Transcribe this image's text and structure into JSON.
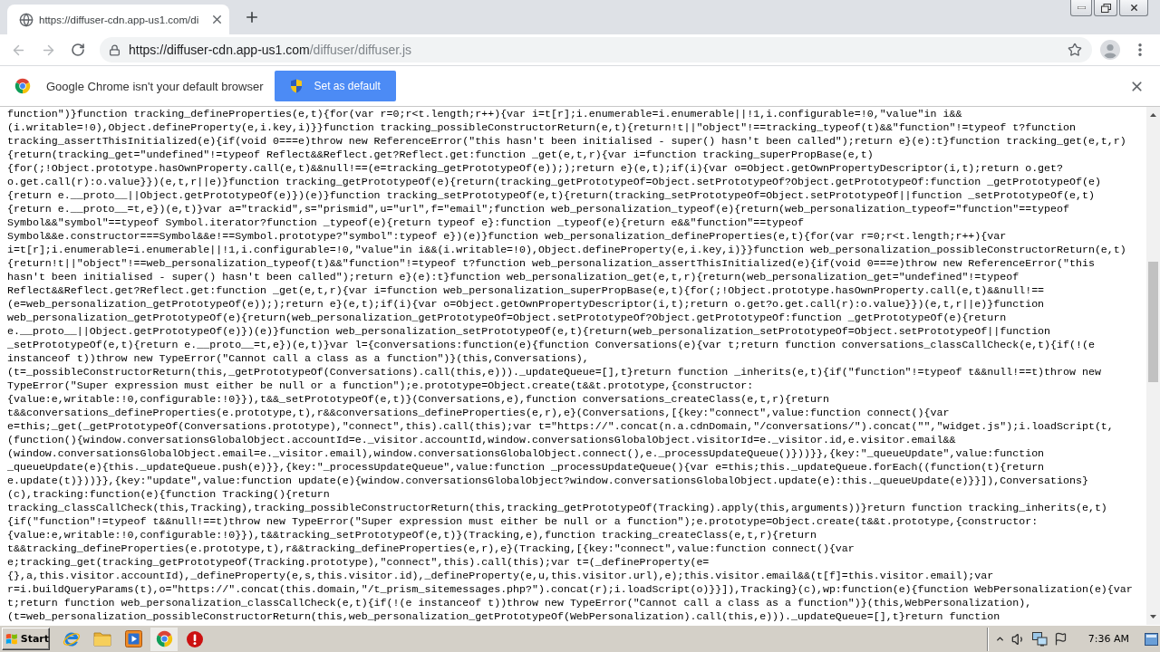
{
  "window": {
    "tabs": [
      {
        "title": "https://diffuser-cdn.app-us1.com/di",
        "selected": true
      }
    ]
  },
  "toolbar": {
    "url_host": "https://diffuser-cdn.app-us1.com",
    "url_path": "/diffuser/diffuser.js"
  },
  "infobar": {
    "message": "Google Chrome isn't your default browser",
    "button": "Set as default"
  },
  "page": {
    "lines": [
      "function\")}function tracking_defineProperties(e,t){for(var r=0;r<t.length;r++){var i=t[r];i.enumerable=i.enumerable||!1,i.configurable=!0,\"value\"in i&&",
      "(i.writable=!0),Object.defineProperty(e,i.key,i)}}function tracking_possibleConstructorReturn(e,t){return!t||\"object\"!==tracking_typeof(t)&&\"function\"!=typeof t?function",
      "tracking_assertThisInitialized(e){if(void 0===e)throw new ReferenceError(\"this hasn't been initialised - super() hasn't been called\");return e}(e):t}function tracking_get(e,t,r)",
      "{return(tracking_get=\"undefined\"!=typeof Reflect&&Reflect.get?Reflect.get:function _get(e,t,r){var i=function tracking_superPropBase(e,t)",
      "{for(;!Object.prototype.hasOwnProperty.call(e,t)&&null!==(e=tracking_getPrototypeOf(e)););return e}(e,t);if(i){var o=Object.getOwnPropertyDescriptor(i,t);return o.get?",
      "o.get.call(r):o.value}})(e,t,r||e)}function tracking_getPrototypeOf(e){return(tracking_getPrototypeOf=Object.setPrototypeOf?Object.getPrototypeOf:function _getPrototypeOf(e)",
      "{return e.__proto__||Object.getPrototypeOf(e)})(e)}function tracking_setPrototypeOf(e,t){return(tracking_setPrototypeOf=Object.setPrototypeOf||function _setPrototypeOf(e,t)",
      "{return e.__proto__=t,e})(e,t)}var a=\"trackid\",s=\"prismid\",u=\"url\",f=\"email\";function web_personalization_typeof(e){return(web_personalization_typeof=\"function\"==typeof",
      "Symbol&&\"symbol\"==typeof Symbol.iterator?function _typeof(e){return typeof e}:function _typeof(e){return e&&\"function\"==typeof",
      "Symbol&&e.constructor===Symbol&&e!==Symbol.prototype?\"symbol\":typeof e})(e)}function web_personalization_defineProperties(e,t){for(var r=0;r<t.length;r++){var",
      "i=t[r];i.enumerable=i.enumerable||!1,i.configurable=!0,\"value\"in i&&(i.writable=!0),Object.defineProperty(e,i.key,i)}}function web_personalization_possibleConstructorReturn(e,t)",
      "{return!t||\"object\"!==web_personalization_typeof(t)&&\"function\"!=typeof t?function web_personalization_assertThisInitialized(e){if(void 0===e)throw new ReferenceError(\"this",
      "hasn't been initialised - super() hasn't been called\");return e}(e):t}function web_personalization_get(e,t,r){return(web_personalization_get=\"undefined\"!=typeof",
      "Reflect&&Reflect.get?Reflect.get:function _get(e,t,r){var i=function web_personalization_superPropBase(e,t){for(;!Object.prototype.hasOwnProperty.call(e,t)&&null!==",
      "(e=web_personalization_getPrototypeOf(e)););return e}(e,t);if(i){var o=Object.getOwnPropertyDescriptor(i,t);return o.get?o.get.call(r):o.value}})(e,t,r||e)}function",
      "web_personalization_getPrototypeOf(e){return(web_personalization_getPrototypeOf=Object.setPrototypeOf?Object.getPrototypeOf:function _getPrototypeOf(e){return",
      "e.__proto__||Object.getPrototypeOf(e)})(e)}function web_personalization_setPrototypeOf(e,t){return(web_personalization_setPrototypeOf=Object.setPrototypeOf||function",
      "_setPrototypeOf(e,t){return e.__proto__=t,e})(e,t)}var l={conversations:function(e){function Conversations(e){var t;return function conversations_classCallCheck(e,t){if(!(e",
      "instanceof t))throw new TypeError(\"Cannot call a class as a function\")}(this,Conversations),",
      "(t=_possibleConstructorReturn(this,_getPrototypeOf(Conversations).call(this,e)))._updateQueue=[],t}return function _inherits(e,t){if(\"function\"!=typeof t&&null!==t)throw new",
      "TypeError(\"Super expression must either be null or a function\");e.prototype=Object.create(t&&t.prototype,{constructor:",
      "{value:e,writable:!0,configurable:!0}}),t&&_setPrototypeOf(e,t)}(Conversations,e),function conversations_createClass(e,t,r){return",
      "t&&conversations_defineProperties(e.prototype,t),r&&conversations_defineProperties(e,r),e}(Conversations,[{key:\"connect\",value:function connect(){var",
      "e=this;_get(_getPrototypeOf(Conversations.prototype),\"connect\",this).call(this);var t=\"https://\".concat(n.a.cdnDomain,\"/conversations/\").concat(\"\",\"widget.js\");i.loadScript(t,",
      "(function(){window.conversationsGlobalObject.accountId=e._visitor.accountId,window.conversationsGlobalObject.visitorId=e._visitor.id,e.visitor.email&&",
      "(window.conversationsGlobalObject.email=e._visitor.email),window.conversationsGlobalObject.connect(),e._processUpdateQueue()}))}},{key:\"_queueUpdate\",value:function",
      "_queueUpdate(e){this._updateQueue.push(e)}},{key:\"_processUpdateQueue\",value:function _processUpdateQueue(){var e=this;this._updateQueue.forEach((function(t){return",
      "e.update(t)}))}},{key:\"update\",value:function update(e){window.conversationsGlobalObject?window.conversationsGlobalObject.update(e):this._queueUpdate(e)}}]),Conversations}",
      "(c),tracking:function(e){function Tracking(){return",
      "tracking_classCallCheck(this,Tracking),tracking_possibleConstructorReturn(this,tracking_getPrototypeOf(Tracking).apply(this,arguments))}return function tracking_inherits(e,t)",
      "{if(\"function\"!=typeof t&&null!==t)throw new TypeError(\"Super expression must either be null or a function\");e.prototype=Object.create(t&&t.prototype,{constructor:",
      "{value:e,writable:!0,configurable:!0}}),t&&tracking_setPrototypeOf(e,t)}(Tracking,e),function tracking_createClass(e,t,r){return",
      "t&&tracking_defineProperties(e.prototype,t),r&&tracking_defineProperties(e,r),e}(Tracking,[{key:\"connect\",value:function connect(){var",
      "e;tracking_get(tracking_getPrototypeOf(Tracking.prototype),\"connect\",this).call(this);var t=(_defineProperty(e=",
      "{},a,this.visitor.accountId),_defineProperty(e,s,this.visitor.id),_defineProperty(e,u,this.visitor.url),e);this.visitor.email&&(t[f]=this.visitor.email);var",
      "r=i.buildQueryParams(t),o=\"https://\".concat(this.domain,\"/t_prism_sitemessages.php?\").concat(r);i.loadScript(o)}}]),Tracking}(c),wp:function(e){function WebPersonalization(e){var",
      "t;return function web_personalization_classCallCheck(e,t){if(!(e instanceof t))throw new TypeError(\"Cannot call a class as a function\")}(this,WebPersonalization),",
      "(t=web_personalization_possibleConstructorReturn(this,web_personalization_getPrototypeOf(WebPersonalization).call(this,e)))._updateQueue=[],t}return function"
    ]
  },
  "taskbar": {
    "start": "Start",
    "apps": [
      {
        "kind": "ie",
        "selected": false
      },
      {
        "kind": "folder",
        "selected": false
      },
      {
        "kind": "media",
        "selected": false
      },
      {
        "kind": "chrome",
        "selected": true
      },
      {
        "kind": "alert",
        "selected": false
      }
    ],
    "clock": "7:36 AM"
  }
}
